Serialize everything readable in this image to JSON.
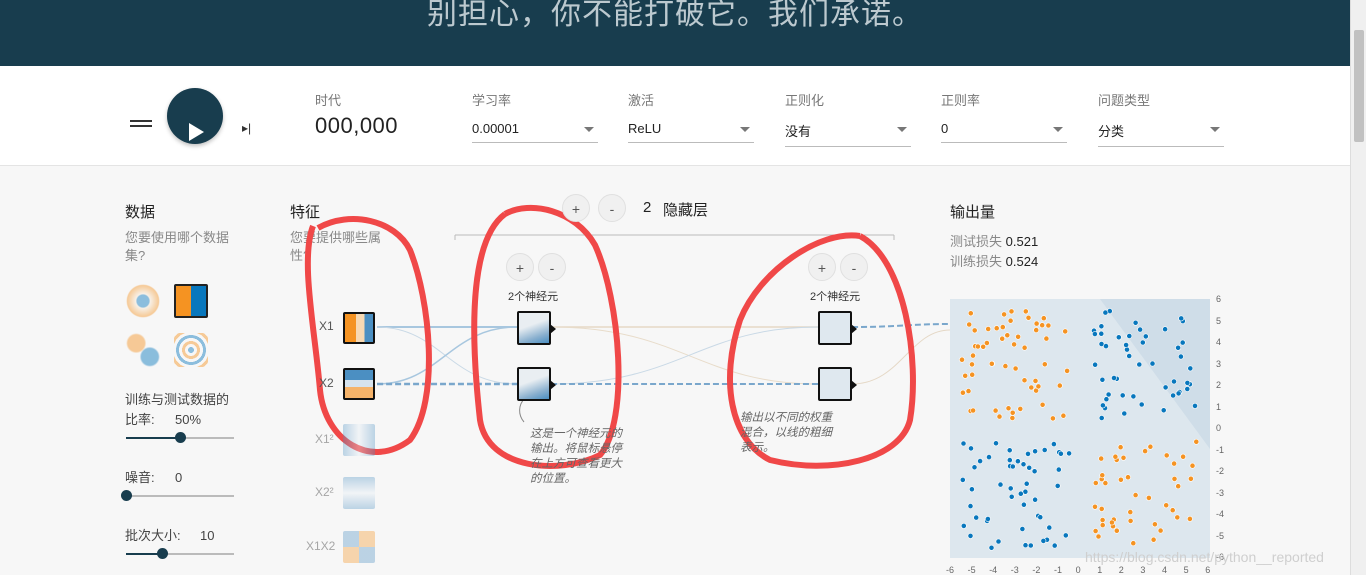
{
  "banner": {
    "text": "别担心，你不能打破它。我们承诺。"
  },
  "controls": {
    "step_icon": "▸|",
    "epoch": {
      "label": "时代",
      "value": "000,000"
    },
    "learning_rate": {
      "label": "学习率",
      "value": "0.00001"
    },
    "activation": {
      "label": "激活",
      "value": "ReLU"
    },
    "regularization": {
      "label": "正则化",
      "value": "没有"
    },
    "reg_rate": {
      "label": "正则率",
      "value": "0"
    },
    "problem_type": {
      "label": "问题类型",
      "value": "分类"
    }
  },
  "data_panel": {
    "title": "数据",
    "subtitle": "您要使用哪个数据集?",
    "ratio_label": "训练与测试数据的比率:",
    "ratio_value": "50%",
    "ratio": 0.5,
    "noise_label": "噪音:",
    "noise_value": "0",
    "noise": 0,
    "batch_label": "批次大小:",
    "batch_value": "10",
    "batch": 0.33
  },
  "features_panel": {
    "title": "特征",
    "subtitle": "您要提供哪些属性?",
    "labels": [
      "X1",
      "X2",
      "X1²",
      "X2²",
      "X1X2"
    ]
  },
  "network": {
    "plus": "+",
    "minus": "-",
    "hidden_count": "2",
    "hidden_label": "隐藏层",
    "layer1_neurons": "2个神经元",
    "layer2_neurons": "2个神经元",
    "note1": "这是一个神经元的输出。将鼠标悬停在上方可查看更大的位置。",
    "note2": "输出以不同的权重混合，以线的粗细表示。"
  },
  "output": {
    "title": "输出量",
    "test_loss_label": "测试损失",
    "test_loss": "0.521",
    "train_loss_label": "训练损失",
    "train_loss": "0.524",
    "y_ticks": [
      "6",
      "5",
      "4",
      "3",
      "2",
      "1",
      "0",
      "-1",
      "-2",
      "-3",
      "-4",
      "-5",
      "-6"
    ],
    "x_ticks": [
      "-6",
      "-5",
      "-4",
      "-3",
      "-2",
      "-1",
      "0",
      "1",
      "2",
      "3",
      "4",
      "5",
      "6"
    ]
  },
  "colors": {
    "orange": "#f59322",
    "blue": "#0877bd",
    "dark": "#183d4e"
  },
  "watermark": "https://blog.csdn.net/python__reported"
}
